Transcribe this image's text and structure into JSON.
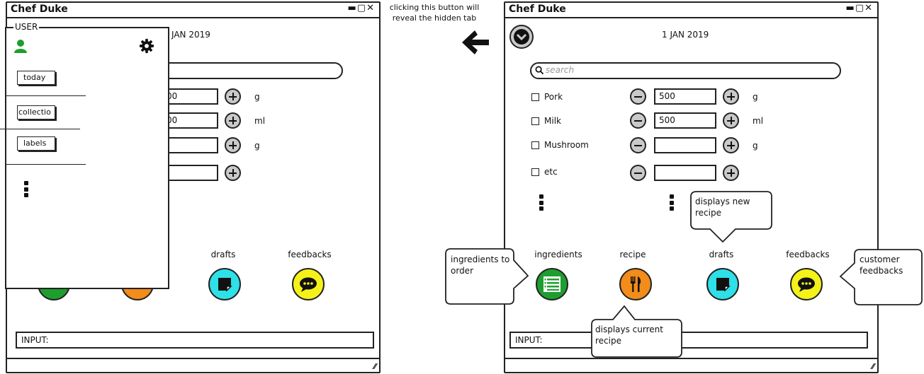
{
  "app": {
    "title": "Chef Duke",
    "window_controls": "▬▢✕"
  },
  "header": {
    "date": "1 JAN 2019",
    "date_partial": "JAN 2019"
  },
  "search": {
    "placeholder": "search"
  },
  "ingredients": [
    {
      "name": "Pork",
      "quantity": "500",
      "unit": "g"
    },
    {
      "name": "Milk",
      "quantity": "500",
      "unit": "ml"
    },
    {
      "name": "Mushroom",
      "quantity": "",
      "unit": "g"
    },
    {
      "name": "etc",
      "quantity": "",
      "unit": ""
    }
  ],
  "left_quantities": [
    "00",
    "00"
  ],
  "tabs": [
    {
      "label": "ingredients",
      "color": "#1e9e2f"
    },
    {
      "label": "recipe",
      "color": "#f28c1a"
    },
    {
      "label": "drafts",
      "color": "#2ee0e8"
    },
    {
      "label": "feedbacks",
      "color": "#f5f21a"
    }
  ],
  "input_bar": {
    "label": "INPUT:"
  },
  "drawer": {
    "legend": "USER",
    "buttons": [
      "today",
      "collectio",
      "labels"
    ]
  },
  "annotations": {
    "hidden_tab_note": "clicking this button will reveal the hidden tab",
    "new_recipe": "displays new recipe",
    "ingredients_to_order": "ingredients to order",
    "current_recipe": "displays current recipe",
    "customer_feedbacks": "customer feedbacks"
  },
  "colors": {
    "user_icon": "#1e9e2f",
    "outline": "#222222",
    "stepper": "#c9c9c9"
  }
}
